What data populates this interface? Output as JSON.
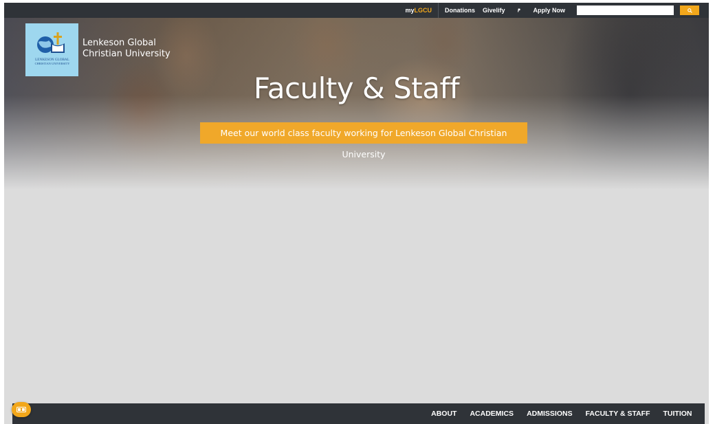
{
  "topbar": {
    "mylgcu_prefix": "my",
    "mylgcu_highlight": "LGCU",
    "donations": "Donations",
    "givelify": "Givelify",
    "paypal_icon": "paypal-icon",
    "apply_now": "Apply Now",
    "search_value": "",
    "search_icon": "search-icon"
  },
  "brand": {
    "name_line1": "Lenkeson Global",
    "name_line2": "Christian University",
    "logo_caption_line1": "LENKESON GLOBAL",
    "logo_caption_line2": "CHRISTIAN UNIVERSITY"
  },
  "hero": {
    "title": "Faculty & Staff",
    "subtitle": "Meet our world class faculty working for Lenkeson Global Christian University"
  },
  "bottom_nav": {
    "items": [
      "ABOUT",
      "ACADEMICS",
      "ADMISSIONS",
      "FACULTY & STAFF",
      "TUITION"
    ]
  },
  "fab": {
    "icon": "accessibility-toggle-icon"
  },
  "colors": {
    "accent": "#f2a71b",
    "bar": "#2f3338",
    "page_bg": "#dcdcdc",
    "logo_bg": "#9ed7ef"
  }
}
